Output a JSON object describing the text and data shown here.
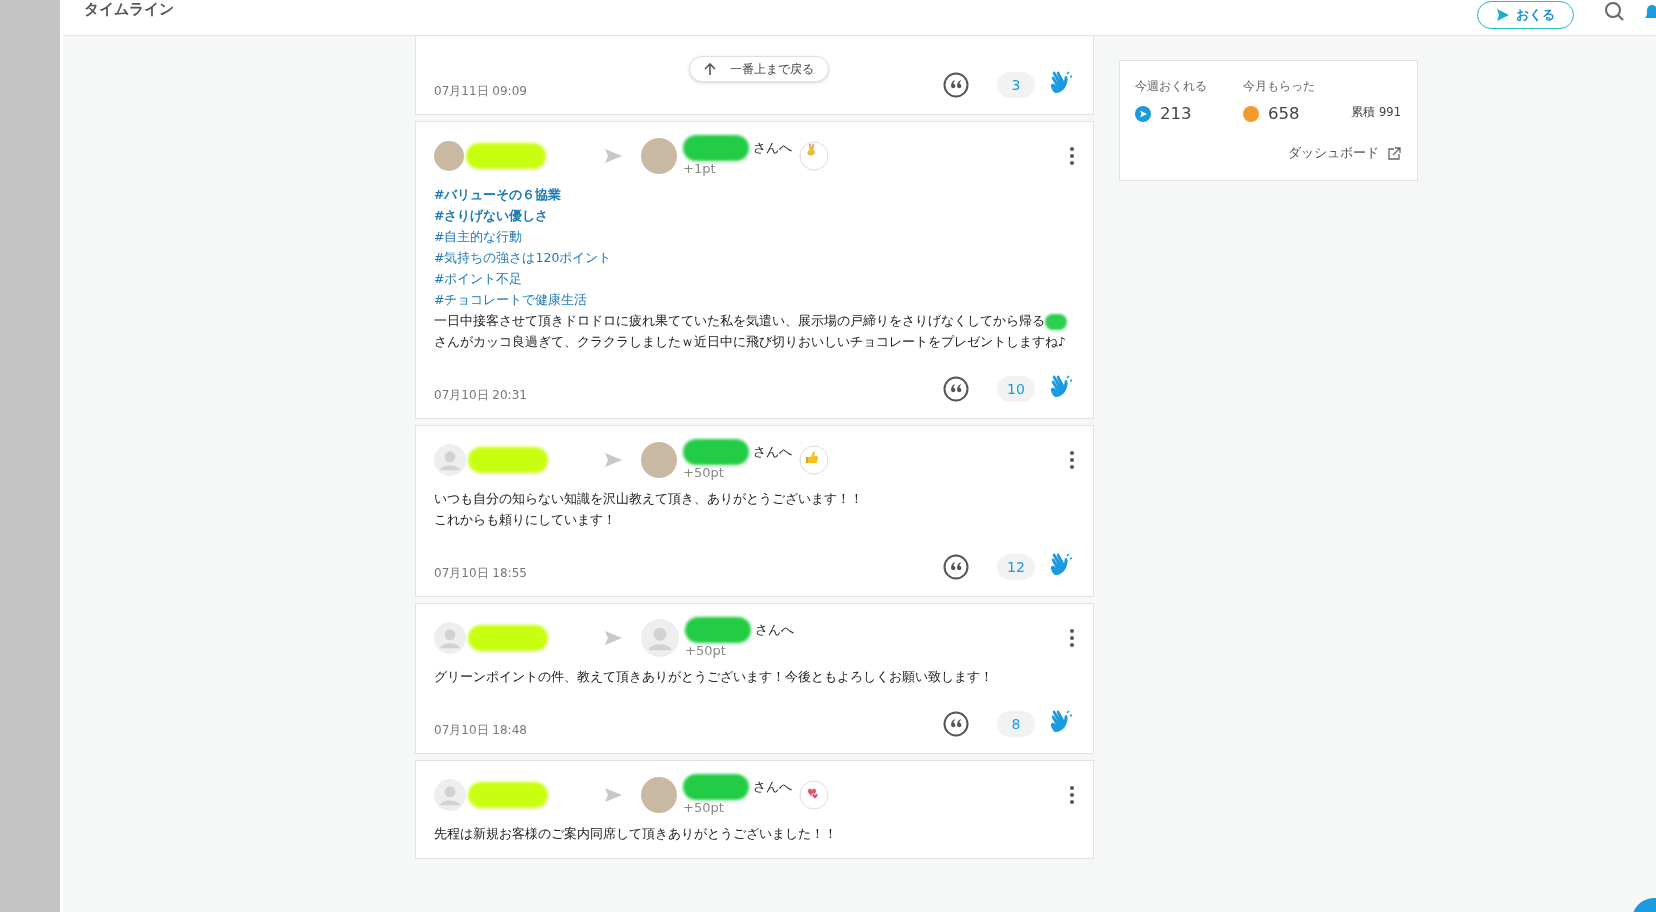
{
  "header": {
    "title": "タイムライン",
    "send_button": "おくる"
  },
  "back_to_top": "一番上まで戻る",
  "partial_post": {
    "date": "07月11日 09:09",
    "count": "3"
  },
  "posts": [
    {
      "sender_avatar": {
        "kind": "photo"
      },
      "recipient_avatar": {
        "kind": "photo"
      },
      "recipient_suffix": "さんへ",
      "points": "+1pt",
      "stamp": {
        "kind": "peace"
      },
      "tags": [
        {
          "text": "#バリューその６協業",
          "bold": true
        },
        {
          "text": "#さりげない優しさ",
          "bold": true
        },
        {
          "text": "#自主的な行動",
          "bold": false
        },
        {
          "text": "#気持ちの強さは120ポイント",
          "bold": false
        },
        {
          "text": "#ポイント不足",
          "bold": false
        },
        {
          "text": "#チョコレートで健康生活",
          "bold": false
        }
      ],
      "body": [
        [
          "一日中接客させて頂きドロドロに疲れ果てていた私を気遣い、展示場の戸締りをさりげなくしてから帰る",
          "さんがカッコ良過ぎて、クラクラしましたｗ近日中に飛び切りおいしいチョコレートをプレゼントしますね♪"
        ]
      ],
      "date": "07月10日 20:31",
      "count": "10"
    },
    {
      "sender_avatar": {
        "kind": "default"
      },
      "recipient_avatar": {
        "kind": "photo"
      },
      "recipient_suffix": "さんへ",
      "points": "+50pt",
      "stamp": {
        "kind": "thumbs-up"
      },
      "body": [
        [
          "いつも自分の知らない知識を沢山教えて頂き、ありがとうございます！！"
        ],
        [
          "これからも頼りにしています！"
        ]
      ],
      "date": "07月10日 18:55",
      "count": "12"
    },
    {
      "sender_avatar": {
        "kind": "default"
      },
      "recipient_avatar": {
        "kind": "default"
      },
      "recipient_suffix": "さんへ",
      "points": "+50pt",
      "body": [
        [
          "グリーンポイントの件、教えて頂きありがとうございます！今後ともよろしくお願い致します！"
        ]
      ],
      "date": "07月10日 18:48",
      "count": "8"
    },
    {
      "sender_avatar": {
        "kind": "default"
      },
      "recipient_avatar": {
        "kind": "photo"
      },
      "recipient_suffix": "さんへ",
      "points": "+50pt",
      "stamp": {
        "kind": "hearts"
      },
      "body": [
        [
          "先程は新規お客様のご案内同席して頂きありがとうございました！！"
        ]
      ]
    }
  ],
  "stats": {
    "send_label": "今週おくれる",
    "send_value": "213",
    "received_label": "今月もらった",
    "received_value": "658",
    "total": "累積 991",
    "dashboard_link": "ダッシュボード"
  }
}
